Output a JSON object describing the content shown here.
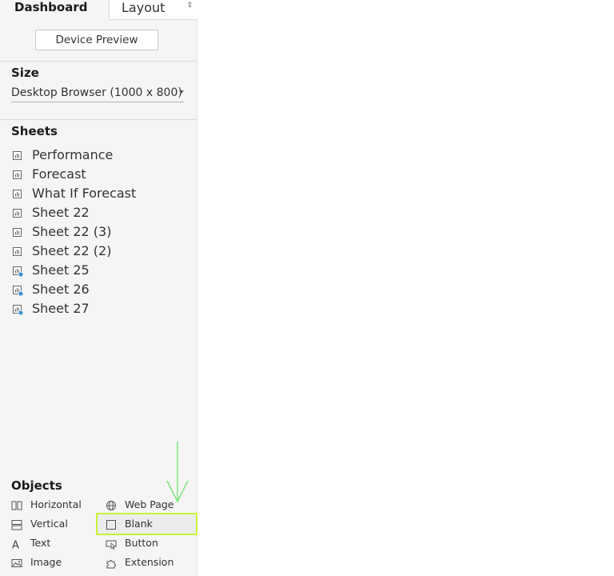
{
  "tabs": {
    "dashboard": "Dashboard",
    "layout": "Layout"
  },
  "device_preview_label": "Device Preview",
  "size": {
    "title": "Size",
    "value": "Desktop Browser (1000 x 800)"
  },
  "sheets": {
    "title": "Sheets",
    "items": [
      {
        "label": "Performance",
        "icon": "worksheet-icon"
      },
      {
        "label": "Forecast",
        "icon": "worksheet-icon"
      },
      {
        "label": "What If Forecast",
        "icon": "worksheet-icon"
      },
      {
        "label": "Sheet 22",
        "icon": "worksheet-icon"
      },
      {
        "label": "Sheet 22 (3)",
        "icon": "worksheet-icon"
      },
      {
        "label": "Sheet 22 (2)",
        "icon": "worksheet-icon"
      },
      {
        "label": "Sheet 25",
        "icon": "worksheet-in-use-icon"
      },
      {
        "label": "Sheet 26",
        "icon": "worksheet-in-use-icon"
      },
      {
        "label": "Sheet 27",
        "icon": "worksheet-in-use-icon"
      }
    ]
  },
  "objects": {
    "title": "Objects",
    "items": [
      {
        "label": "Horizontal",
        "icon": "horizontal-container-icon"
      },
      {
        "label": "Web Page",
        "icon": "globe-icon"
      },
      {
        "label": "Vertical",
        "icon": "vertical-container-icon"
      },
      {
        "label": "Blank",
        "icon": "blank-icon"
      },
      {
        "label": "Text",
        "icon": "text-icon"
      },
      {
        "label": "Button",
        "icon": "button-icon"
      },
      {
        "label": "Image",
        "icon": "image-icon"
      },
      {
        "label": "Extension",
        "icon": "extension-icon"
      }
    ]
  },
  "colors": {
    "highlight_border": "#c9f23a",
    "arrow": "#7de87d",
    "in_use_badge": "#3a8fd0"
  }
}
